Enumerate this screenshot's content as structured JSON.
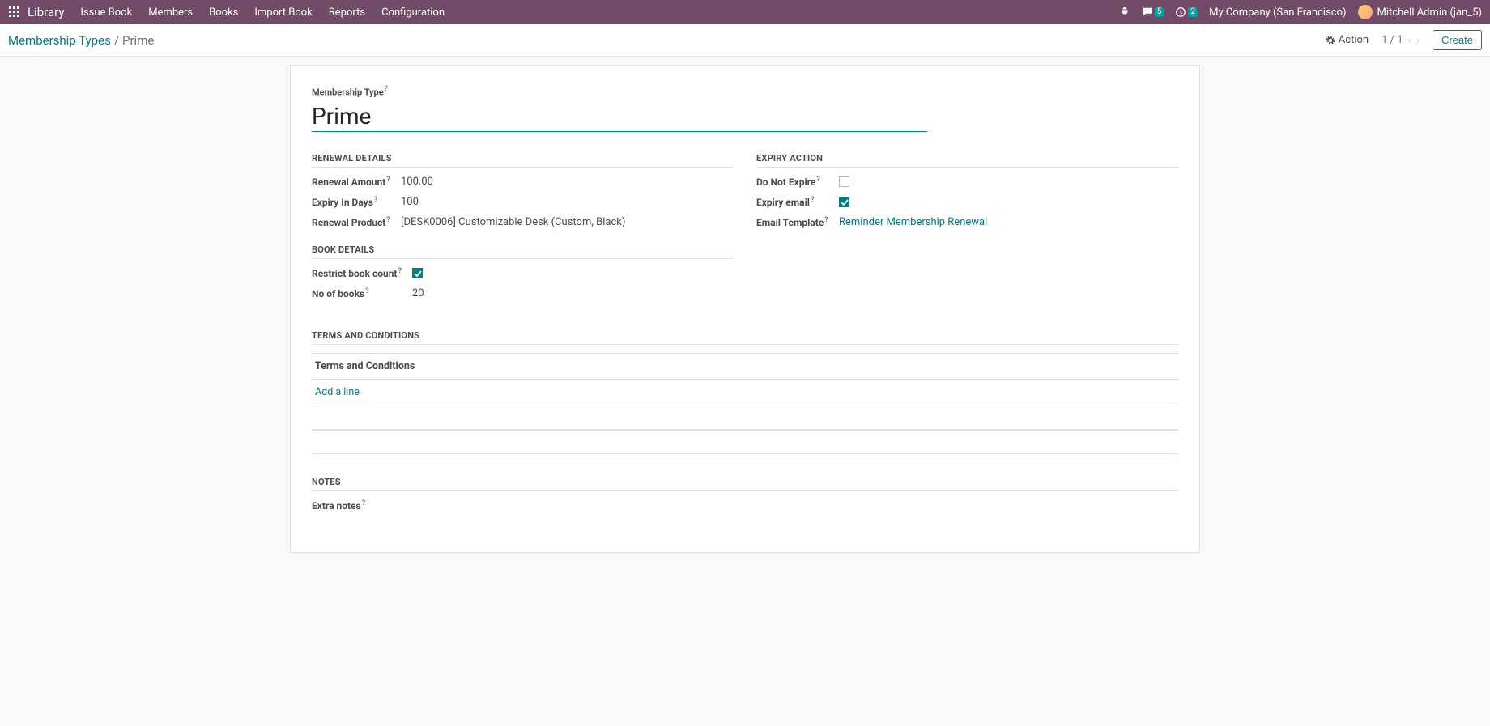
{
  "nav": {
    "brand": "Library",
    "menu": [
      "Issue Book",
      "Members",
      "Books",
      "Import Book",
      "Reports",
      "Configuration"
    ],
    "msg_badge": "5",
    "activity_badge": "2",
    "company": "My Company (San Francisco)",
    "user": "Mitchell Admin (jan_5)"
  },
  "control": {
    "breadcrumb_root": "Membership Types",
    "breadcrumb_current": "Prime",
    "action_label": "Action",
    "pager": "1 / 1",
    "create_label": "Create"
  },
  "form": {
    "title_label": "Membership Type",
    "title_value": "Prime",
    "renewal": {
      "section": "RENEWAL DETAILS",
      "amount_label": "Renewal Amount",
      "amount_value": "100.00",
      "expiry_days_label": "Expiry In Days",
      "expiry_days_value": "100",
      "product_label": "Renewal Product",
      "product_value": "[DESK0006] Customizable Desk (Custom, Black)"
    },
    "expiry": {
      "section": "EXPIRY ACTION",
      "do_not_expire_label": "Do Not Expire",
      "do_not_expire_checked": false,
      "expiry_email_label": "Expiry email",
      "expiry_email_checked": true,
      "template_label": "Email Template",
      "template_value": "Reminder Membership Renewal"
    },
    "book": {
      "section": "BOOK DETAILS",
      "restrict_label": "Restrict book count",
      "restrict_checked": true,
      "no_books_label": "No of books",
      "no_books_value": "20"
    },
    "terms": {
      "section": "TERMS AND CONDITIONS",
      "col_header": "Terms and Conditions",
      "add_line": "Add a line"
    },
    "notes": {
      "section": "NOTES",
      "extra_label": "Extra notes"
    }
  }
}
